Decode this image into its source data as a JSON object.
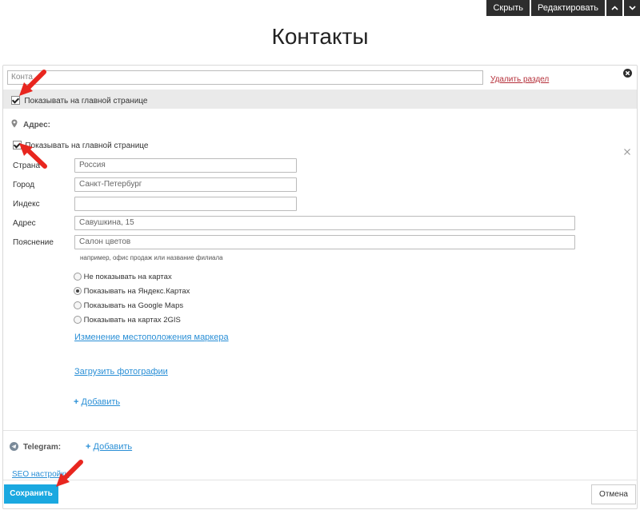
{
  "topbar": {
    "hide_label": "Скрыть",
    "edit_label": "Редактировать"
  },
  "page": {
    "title": "Контакты"
  },
  "section": {
    "title_value": "Конта",
    "delete_label": "Удалить раздел",
    "show_main_label": "Показывать на главной странице"
  },
  "address": {
    "heading": "Адрес:",
    "show_main_label": "Показывать на главной странице",
    "fields": [
      {
        "label": "Страна",
        "value": "Россия"
      },
      {
        "label": "Город",
        "value": "Санкт-Петербург"
      },
      {
        "label": "Индекс",
        "value": ""
      },
      {
        "label": "Адрес",
        "value": "Савушкина, 15"
      },
      {
        "label": "Пояснение",
        "value": "Салон цветов"
      }
    ],
    "hint": "например, офис продаж или название филиала",
    "map_options": [
      {
        "label": "Не показывать на картах",
        "selected": false
      },
      {
        "label": "Показывать на Яндекс.Картах",
        "selected": true
      },
      {
        "label": "Показывать на Google Maps",
        "selected": false
      },
      {
        "label": "Показывать на картах 2GIS",
        "selected": false
      }
    ],
    "change_marker_label": "Изменение местоположения маркера",
    "upload_photos_label": "Загрузить фотографии",
    "add_label": "Добавить"
  },
  "telegram": {
    "label": "Telegram:",
    "add_label": "Добавить"
  },
  "seo_label": "SEO настройки",
  "save_label": "Сохранить",
  "cancel_label": "Отмена",
  "colors": {
    "accent": "#1aa8e0",
    "link": "#2a8fd6",
    "annotation_arrow": "#e8261f"
  }
}
